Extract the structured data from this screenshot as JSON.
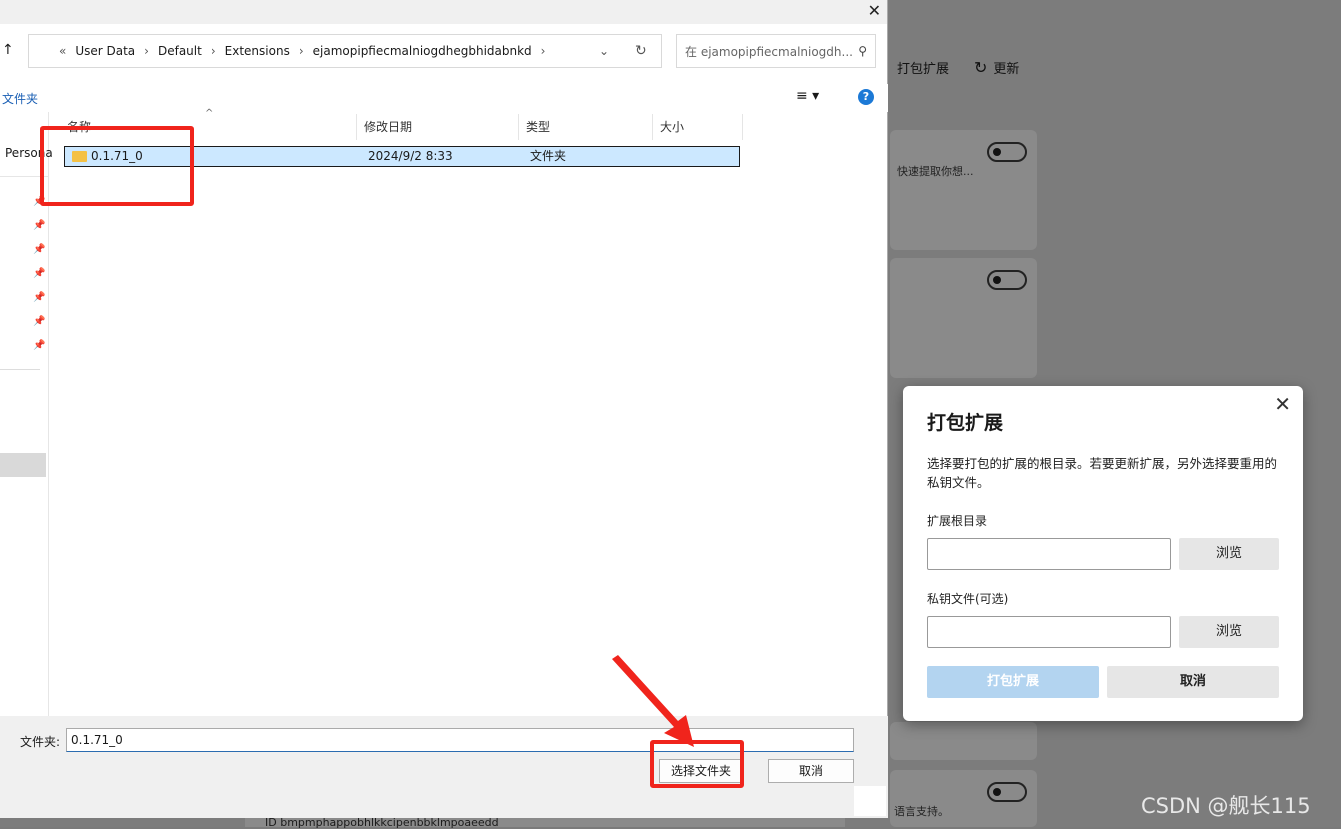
{
  "background_page": {
    "pack_extension": "打包扩展",
    "update": "更新",
    "card1_text": "快速提取你想...",
    "card_bottom_text": "语言支持。",
    "bottom_id": "ID bmpmphappobhlkkcipenbbklmpoaeedd"
  },
  "file_dialog": {
    "close_glyph": "✕",
    "breadcrumb": [
      "«",
      "User Data",
      "Default",
      "Extensions",
      "ejamopipfiecmalniogdhegbhidabnkd"
    ],
    "search_placeholder": "在 ejamopipfiecmalniogdh...",
    "view_label": "文件夹",
    "sidebar_item": "Persona",
    "columns": [
      "名称",
      "修改日期",
      "类型",
      "大小"
    ],
    "rows": [
      {
        "name": "0.1.71_0",
        "date": "2024/9/2 8:33",
        "type": "文件夹",
        "size": ""
      }
    ],
    "folder_label": "文件夹:",
    "folder_value": "0.1.71_0",
    "select_button": "选择文件夹",
    "cancel_button": "取消"
  },
  "pack_dialog": {
    "title": "打包扩展",
    "close_glyph": "✕",
    "description": "选择要打包的扩展的根目录。若要更新扩展，另外选择要重用的私钥文件。",
    "root_label": "扩展根目录",
    "browse": "浏览",
    "key_label": "私钥文件(可选)",
    "browse2": "浏览",
    "pack_button": "打包扩展",
    "cancel_button": "取消"
  },
  "watermark": "CSDN @舰长115",
  "colors": {
    "accent": "#cce8ff",
    "highlight": "#f0241c",
    "pack_disabled": "#b3d4f0"
  }
}
